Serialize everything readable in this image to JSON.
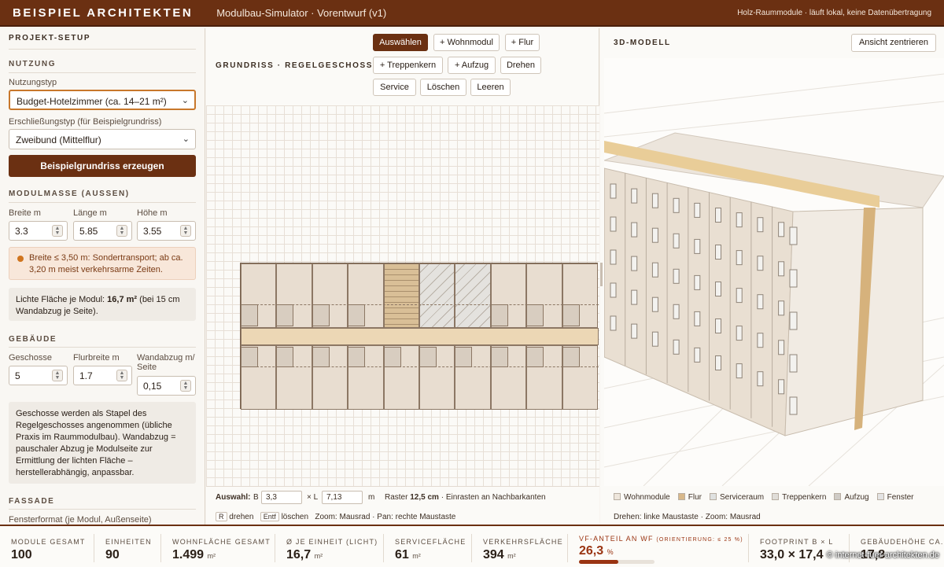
{
  "topbar": {
    "brand": "BEISPIEL ARCHITEKTEN",
    "subtitle": "Modulbau-Simulator · Vorentwurf (v1)",
    "right": "Holz-Raummodule · läuft lokal, keine Datenübertragung"
  },
  "sidebar": {
    "title": "PROJEKT-SETUP",
    "nutzung": {
      "title": "NUTZUNG",
      "type_label": "Nutzungstyp",
      "type_value": "Budget-Hotelzimmer (ca. 14–21 m²)",
      "erschl_label": "Erschließungstyp (für Beispielgrundriss)",
      "erschl_value": "Zweibund (Mittelflur)",
      "generate_button": "Beispielgrundriss erzeugen"
    },
    "module": {
      "title": "MODULMASSE (AUSSEN)",
      "breite_label": "Breite m",
      "breite": "3.3",
      "laenge_label": "Länge m",
      "laenge": "5.85",
      "hoehe_label": "Höhe m",
      "hoehe": "3.55",
      "warning": "Breite ≤ 3,50 m: Sondertransport; ab ca. 3,20 m meist verkehrsarme Zeiten.",
      "flaeche_pre": "Lichte Fläche je Modul: ",
      "flaeche_val": "16,7 m²",
      "flaeche_post": " (bei 15 cm Wandabzug je Seite)."
    },
    "gebaeude": {
      "title": "GEBÄUDE",
      "geschosse_label": "Geschosse",
      "geschosse": "5",
      "flur_label": "Flurbreite m",
      "flur": "1.7",
      "wand_label": "Wandabzug m/ Seite",
      "wand": "0,15",
      "note": "Geschosse werden als Stapel des Regelgeschosses angenommen (übliche Praxis im Raummodulbau). Wandabzug = pauschaler Abzug je Modulseite zur Ermittlung der lichten Fläche – herstellerabhängig, anpassbar."
    },
    "fassade": {
      "title": "FASSADE",
      "fenster_label": "Fensterformat (je Modul, Außenseite)"
    }
  },
  "plan": {
    "title": "GRUNDRISS · REGELGESCHOSS",
    "tools": {
      "select": "Auswählen",
      "wohnmodul": "+ Wohnmodul",
      "flur": "+ Flur",
      "treppe": "+ Treppenkern",
      "aufzug": "+ Aufzug",
      "drehen": "Drehen",
      "service": "Service",
      "loeschen": "Löschen",
      "leeren": "Leeren"
    },
    "measure": {
      "auswahl": "Auswahl:",
      "b_label": "B",
      "b_value": "3,3",
      "l_label": "× L",
      "l_value": "7,13",
      "unit": "m",
      "raster_pre": "Raster ",
      "raster_val": "12,5 cm",
      "raster_post": " · Einrasten an Nachbarkanten",
      "key_r": "R",
      "drehen": "drehen",
      "key_entf": "Entf",
      "loeschen": "löschen",
      "hint": "Zoom: Mausrad · Pan: rechte Maustaste"
    }
  },
  "model3d": {
    "title": "3D-MODELL",
    "center_button": "Ansicht zentrieren",
    "hint": "Drehen: linke Maustaste · Zoom: Mausrad",
    "legend": [
      {
        "label": "Wohnmodule",
        "color": "#eee6dc"
      },
      {
        "label": "Flur",
        "color": "#d8b88a"
      },
      {
        "label": "Serviceraum",
        "color": "#dfe1e0"
      },
      {
        "label": "Treppenkern",
        "color": "#e0ddd8"
      },
      {
        "label": "Aufzug",
        "color": "#cfcbc6"
      },
      {
        "label": "Fenster",
        "color": "#e3e3e3"
      }
    ]
  },
  "stats": {
    "module": {
      "label": "MODULE GESAMT",
      "value": "100"
    },
    "einheiten": {
      "label": "EINHEITEN",
      "value": "90"
    },
    "wohnflaeche": {
      "label": "WOHNFLÄCHE GESAMT",
      "value": "1.499",
      "unit": "m²"
    },
    "je_einheit": {
      "label": "Ø JE EINHEIT (LICHT)",
      "value": "16,7",
      "unit": "m²"
    },
    "service": {
      "label": "SERVICEFLÄCHE",
      "value": "61",
      "unit": "m²"
    },
    "verkehr": {
      "label": "VERKEHRSFLÄCHE",
      "value": "394",
      "unit": "m²"
    },
    "vf": {
      "label": "VF-ANTEIL AN WF",
      "orient": "(ORIENTIERUNG: ≤ 25 %)",
      "value": "26,3",
      "unit": "%",
      "fraction": 0.263
    },
    "footprint": {
      "label": "FOOTPRINT B × L",
      "value": "33,0 × 17,4"
    },
    "hoehe": {
      "label": "GEBÄUDEHÖHE CA.",
      "value": "17,8"
    }
  },
  "watermark": "© internet-fuer-architekten.de",
  "colors": {
    "brand": "#6b3012",
    "corridor": "#ecd7b5",
    "module": "#e8ddd0"
  }
}
